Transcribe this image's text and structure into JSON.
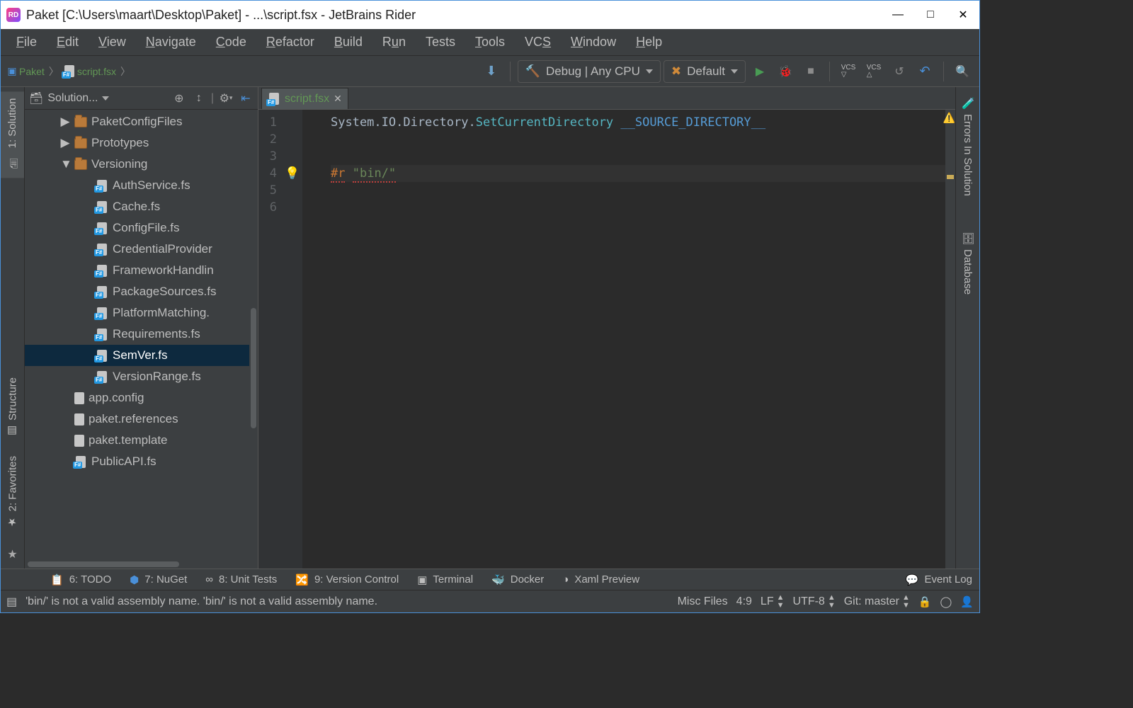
{
  "window": {
    "title": "Paket [C:\\Users\\maart\\Desktop\\Paket] - ...\\script.fsx - JetBrains Rider"
  },
  "menu": {
    "items": [
      "File",
      "Edit",
      "View",
      "Navigate",
      "Code",
      "Refactor",
      "Build",
      "Run",
      "Tests",
      "Tools",
      "VCS",
      "Window",
      "Help"
    ]
  },
  "breadcrumbs": {
    "project": "Paket",
    "file": "script.fsx"
  },
  "run_config": "Debug | Any CPU",
  "run_target": "Default",
  "solution_panel": {
    "title": "Solution...",
    "tree": [
      {
        "indent": 1,
        "type": "folder",
        "arrow": "▶",
        "label": "PaketConfigFiles"
      },
      {
        "indent": 1,
        "type": "folder",
        "arrow": "▶",
        "label": "Prototypes"
      },
      {
        "indent": 1,
        "type": "folder",
        "arrow": "▼",
        "label": "Versioning"
      },
      {
        "indent": 2,
        "type": "fs",
        "label": "AuthService.fs"
      },
      {
        "indent": 2,
        "type": "fs",
        "label": "Cache.fs"
      },
      {
        "indent": 2,
        "type": "fs",
        "label": "ConfigFile.fs"
      },
      {
        "indent": 2,
        "type": "fs",
        "label": "CredentialProvider"
      },
      {
        "indent": 2,
        "type": "fs",
        "label": "FrameworkHandlin"
      },
      {
        "indent": 2,
        "type": "fs",
        "label": "PackageSources.fs"
      },
      {
        "indent": 2,
        "type": "fs",
        "label": "PlatformMatching."
      },
      {
        "indent": 2,
        "type": "fs",
        "label": "Requirements.fs"
      },
      {
        "indent": 2,
        "type": "fs",
        "label": "SemVer.fs",
        "selected": true
      },
      {
        "indent": 2,
        "type": "fs",
        "label": "VersionRange.fs"
      },
      {
        "indent": 1,
        "type": "file",
        "label": "app.config"
      },
      {
        "indent": 1,
        "type": "lines",
        "label": "paket.references"
      },
      {
        "indent": 1,
        "type": "lines",
        "label": "paket.template"
      },
      {
        "indent": 1,
        "type": "fs",
        "label": "PublicAPI.fs"
      }
    ]
  },
  "left_tools": {
    "solution": "1: Solution",
    "structure": "Structure",
    "favorites": "2: Favorites"
  },
  "right_tools": {
    "errors": "Errors In Solution",
    "database": "Database"
  },
  "editor": {
    "tab": "script.fsx",
    "lines_count": 6,
    "code": {
      "l1": {
        "pre": "System.IO.Directory.",
        "method": "SetCurrentDirectory",
        "post": " ",
        "dir": "__SOURCE_DIRECTORY__"
      },
      "l4": {
        "r": "#r",
        "str": "\"bin/\""
      }
    }
  },
  "bottom_tools": {
    "todo": "6: TODO",
    "nuget": "7: NuGet",
    "unit": "8: Unit Tests",
    "vcs": "9: Version Control",
    "terminal": "Terminal",
    "docker": "Docker",
    "xaml": "Xaml Preview",
    "eventlog": "Event Log"
  },
  "status": {
    "message": "'bin/' is not a valid assembly name. 'bin/' is not a valid assembly name.",
    "misc": "Misc Files",
    "pos": "4:9",
    "le": "LF",
    "enc": "UTF-8",
    "git": "Git: master"
  }
}
